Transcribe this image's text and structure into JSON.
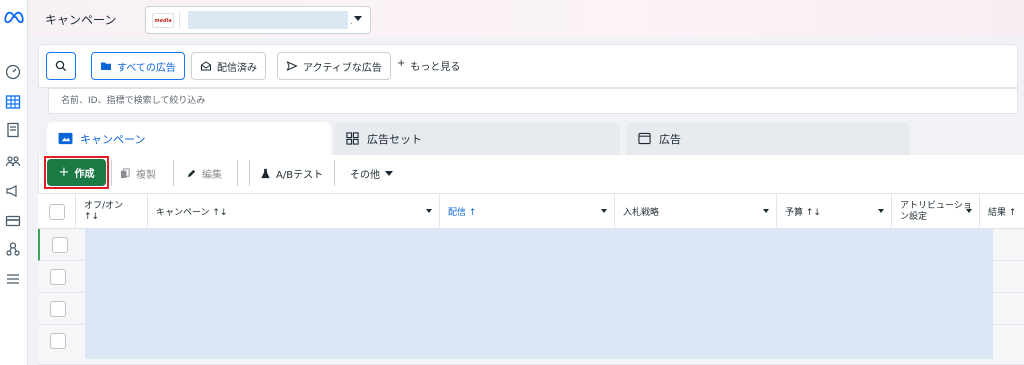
{
  "topbar": {
    "title": "キャンペーン",
    "account_logo_text": "media"
  },
  "filters": {
    "all_ads": "すべての広告",
    "delivered": "配信済み",
    "active_ads": "アクティブな広告",
    "more": "もっと見る",
    "search_placeholder": "名前、ID、指標で検索して絞り込み"
  },
  "tabs": {
    "campaign": "キャンペーン",
    "adset": "広告セット",
    "ad": "広告"
  },
  "toolbar": {
    "create": "作成",
    "duplicate": "複製",
    "edit": "編集",
    "ab_test": "A/Bテスト",
    "other": "その他"
  },
  "table": {
    "col_onoff": "オフ/オン",
    "col_onoff_sort": "↑↓",
    "col_campaign": "キャンペーン ↑↓",
    "col_delivery": "配信 ↑",
    "col_bid": "入札戦略",
    "col_budget": "予算 ↑↓",
    "col_attribution_1": "アトリビューショ",
    "col_attribution_2": "ン設定",
    "col_results": "結果 ↑"
  },
  "colors": {
    "accent_blue": "#1877f2",
    "create_green": "#1b7a43",
    "highlight_red": "#e41e26"
  }
}
